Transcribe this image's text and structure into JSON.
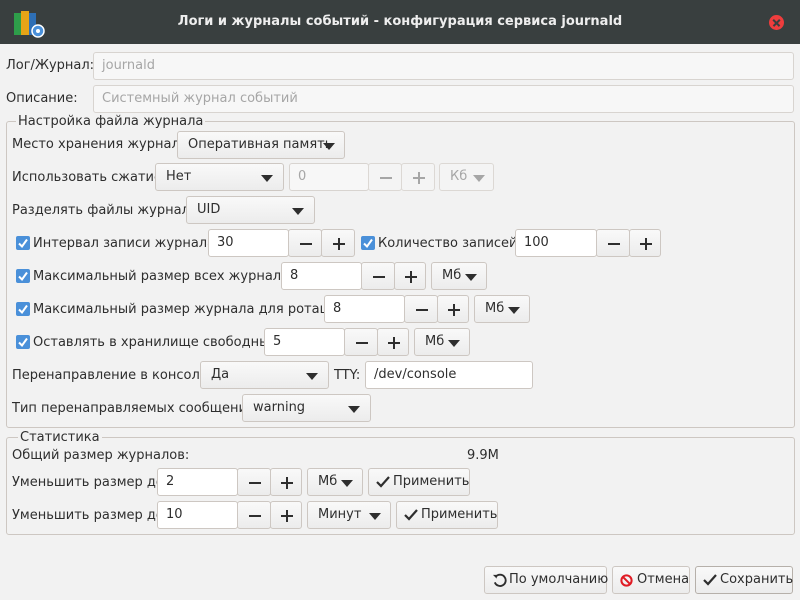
{
  "window": {
    "title": "Логи и журналы событий - конфигурация сервиса journald"
  },
  "log": {
    "label": "Лог/Журнал:",
    "placeholder": "journald"
  },
  "description": {
    "label": "Описание:",
    "placeholder": "Системный журнал событий"
  },
  "file_settings": {
    "legend": "Настройка файла журнала",
    "storage": {
      "label": "Место хранения журнала:",
      "value": "Оперативная память"
    },
    "compress": {
      "label": "Использовать сжатие:",
      "value": "Нет",
      "amount": "0",
      "unit": "Кб"
    },
    "split": {
      "label": "Разделять файлы журнала:",
      "value": "UID"
    },
    "sync_interval": {
      "label": "Интервал записи журнала:",
      "value": "30",
      "checked": true
    },
    "records_count": {
      "label": "Количество записей:",
      "value": "100",
      "checked": true
    },
    "max_total_size": {
      "label": "Максимальный размер всех журналов:",
      "value": "8",
      "unit": "Мб",
      "checked": true
    },
    "max_rotate_size": {
      "label": "Максимальный размер журнала для ротации:",
      "value": "8",
      "unit": "Мб",
      "checked": true
    },
    "keep_free": {
      "label": "Оставлять в хранилище свободным:",
      "value": "5",
      "unit": "Мб",
      "checked": true
    },
    "forward_console": {
      "label": "Перенаправление в консоль:",
      "value": "Да",
      "tty_label": "TTY:",
      "tty_value": "/dev/console"
    },
    "forward_level": {
      "label": "Тип перенаправляемых сообщений:",
      "value": "warning"
    }
  },
  "stats": {
    "legend": "Статистика",
    "total_label": "Общий размер журналов:",
    "total_value": "9.9M",
    "reduce_size": {
      "label": "Уменьшить размер до:",
      "value": "2",
      "unit": "Мб",
      "apply": "Применить"
    },
    "reduce_time": {
      "label": "Уменьшить размер до:",
      "value": "10",
      "unit": "Минут",
      "apply": "Применить"
    }
  },
  "footer": {
    "defaults": "По умолчанию",
    "cancel": "Отмена",
    "save": "Сохранить"
  },
  "colors": {
    "titlebar": "#393f3f",
    "accent": "#4a90d9",
    "close": "#ef3d3d",
    "cancel_icon": "#e01b24"
  }
}
